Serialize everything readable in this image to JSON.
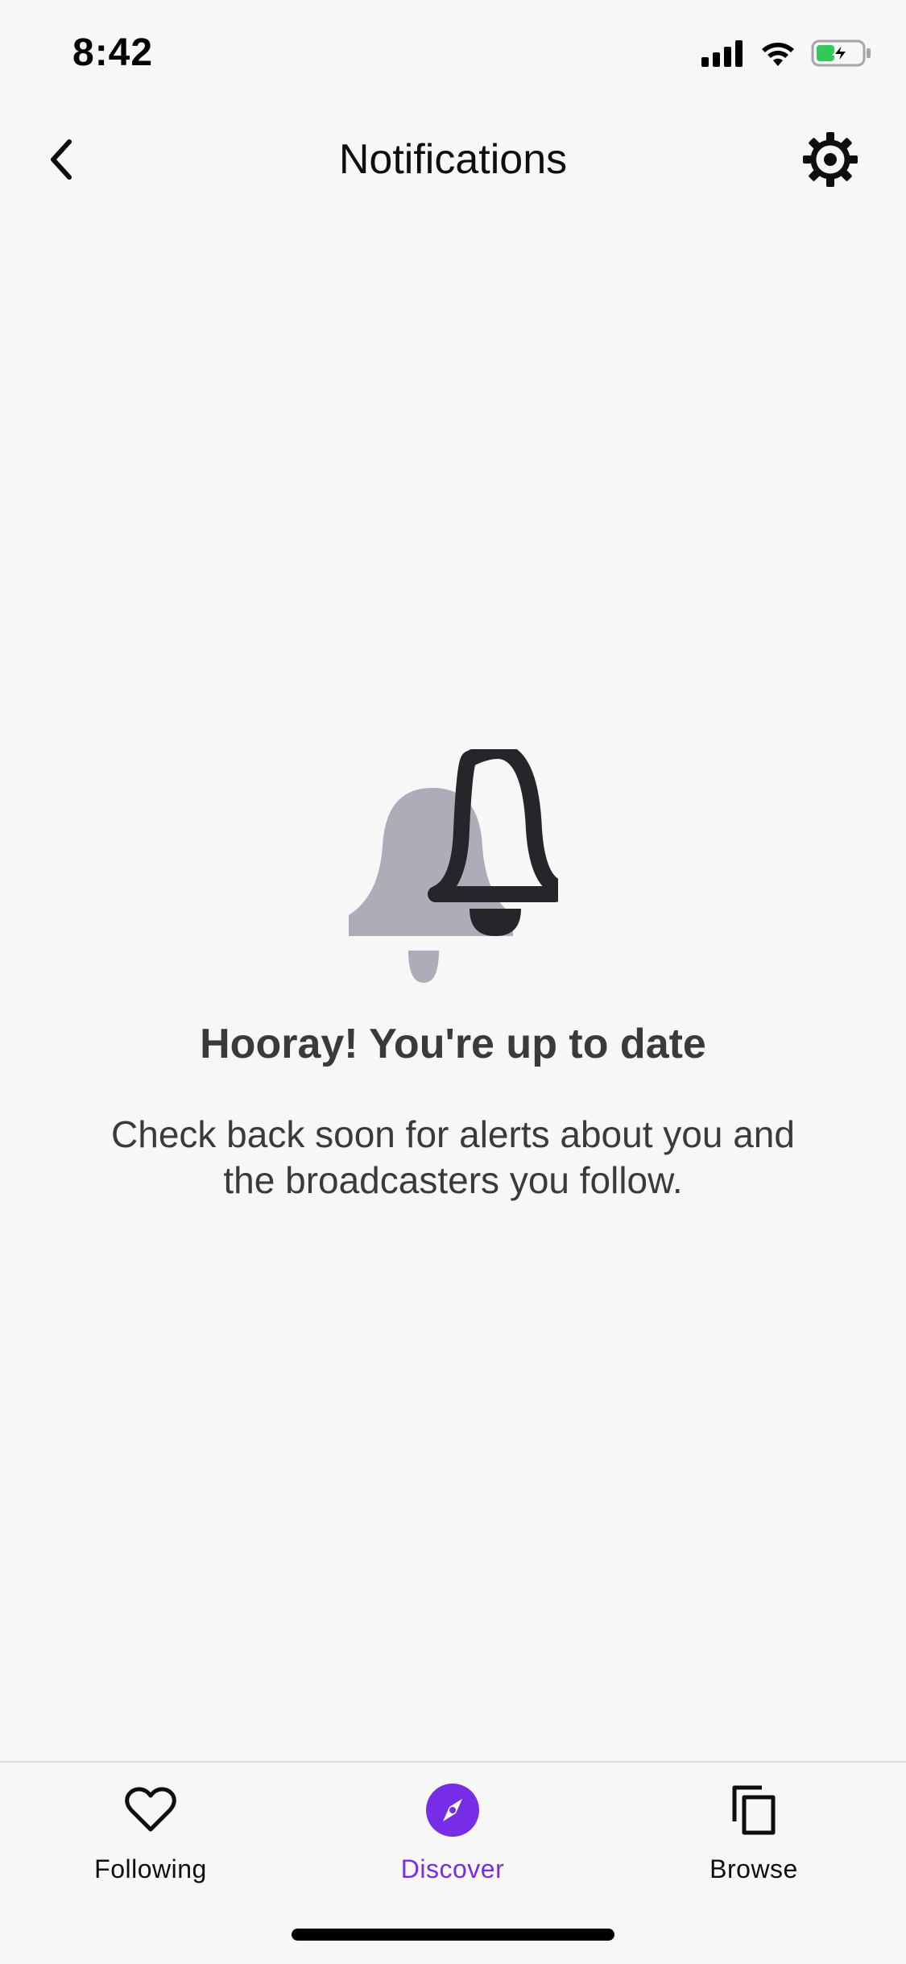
{
  "status_bar": {
    "time": "8:42",
    "icons": [
      "signal-icon",
      "wifi-icon",
      "battery-charging-icon"
    ],
    "battery_color": "#34c759"
  },
  "header": {
    "title": "Notifications",
    "back_icon": "chevron-left-icon",
    "settings_icon": "gear-icon"
  },
  "empty_state": {
    "icon": "bell-icon",
    "title": "Hooray! You're up to date",
    "message": "Check back soon for alerts about you and the broadcasters you follow."
  },
  "tab_bar": {
    "active_tab": "discover",
    "active_color": "#772ce8",
    "tabs": [
      {
        "id": "following",
        "label": "Following",
        "icon": "heart-icon"
      },
      {
        "id": "discover",
        "label": "Discover",
        "icon": "compass-icon"
      },
      {
        "id": "browse",
        "label": "Browse",
        "icon": "copy-pages-icon"
      }
    ]
  }
}
